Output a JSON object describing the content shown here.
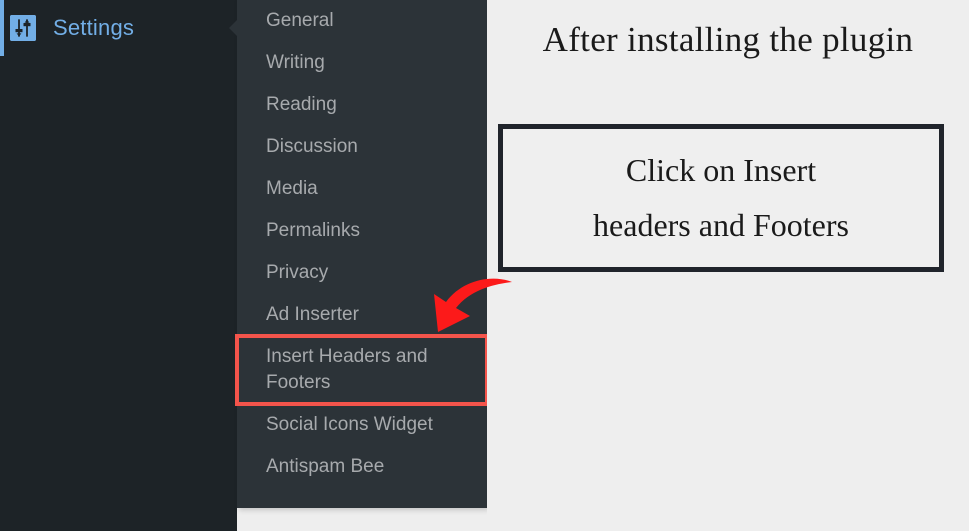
{
  "sidebar": {
    "settings": {
      "label": "Settings",
      "icon": "settings-sliders-icon",
      "accent_color": "#72aee6",
      "background": "#1d2327"
    }
  },
  "flyout": {
    "background": "#2c3338",
    "text_color": "#a7aaad",
    "items": [
      {
        "label": "General",
        "highlighted": false
      },
      {
        "label": "Writing",
        "highlighted": false
      },
      {
        "label": "Reading",
        "highlighted": false
      },
      {
        "label": "Discussion",
        "highlighted": false
      },
      {
        "label": "Media",
        "highlighted": false
      },
      {
        "label": "Permalinks",
        "highlighted": false
      },
      {
        "label": "Privacy",
        "highlighted": false
      },
      {
        "label": "Ad Inserter",
        "highlighted": false
      },
      {
        "label": "Insert Headers and\nFooters",
        "highlighted": true
      },
      {
        "label": "Social Icons Widget",
        "highlighted": false
      },
      {
        "label": "Antispam Bee",
        "highlighted": false
      }
    ],
    "highlight_color": "#f4544b"
  },
  "content": {
    "headline": "After installing the plugin",
    "callout": {
      "text": "Click on Insert\nheaders and Footers",
      "border_color": "#20242b",
      "background": "#efefef"
    },
    "annotation_arrow": {
      "icon": "curved-down-left-arrow-icon",
      "color": "#fc1a1a"
    }
  }
}
